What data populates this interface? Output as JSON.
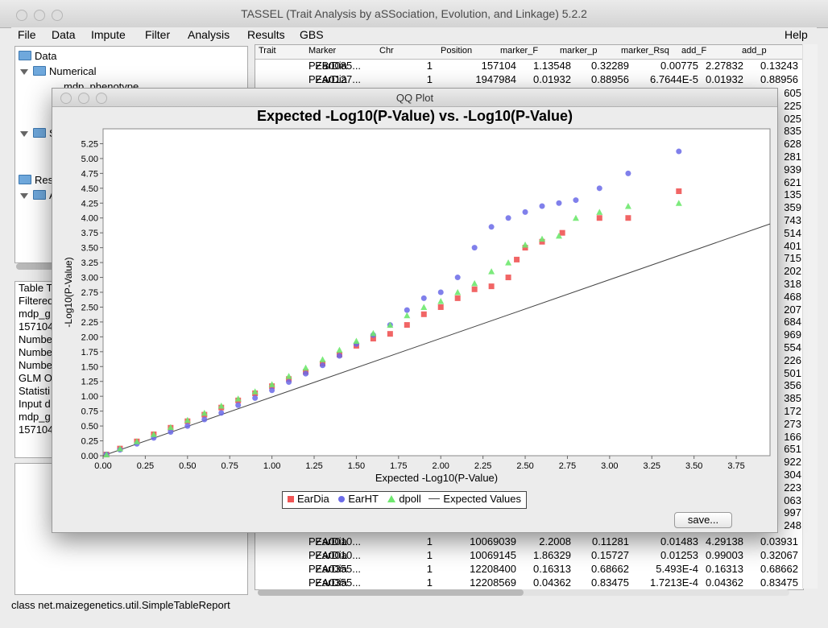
{
  "window": {
    "title": "TASSEL (Trait Analysis by aSSociation, Evolution, and Linkage) 5.2.2"
  },
  "menu": [
    "File",
    "Data",
    "Impute",
    "Filter",
    "Analysis",
    "Results",
    "GBS"
  ],
  "menu_help": "Help",
  "tree": {
    "data": "Data",
    "numerical": "Numerical",
    "phenotype": "mdp_phenotype",
    "s_node": "S",
    "results": "Resu",
    "a_node": "A"
  },
  "info": [
    "Table T",
    "Filtered",
    "mdp_g",
    "157104",
    "Numbe",
    "Numbe",
    "Numbe",
    "GLM O",
    "Statisti",
    "Input d",
    "mdp_g",
    "157104"
  ],
  "table": {
    "headers": [
      "Trait",
      "Marker",
      "Chr",
      "Position",
      "marker_F",
      "marker_p",
      "marker_Rsq",
      "add_F",
      "add_p"
    ],
    "top_rows": [
      [
        "EarDia",
        "PZB0085...",
        "1",
        "157104",
        "1.13548",
        "0.32289",
        "0.00775",
        "2.27832",
        "0.13243"
      ],
      [
        "EarDia",
        "PZA0127...",
        "1",
        "1947984",
        "0.01932",
        "0.88956",
        "6.7644E-5",
        "0.01932",
        "0.88956"
      ]
    ],
    "right_values": [
      "605",
      "225",
      "025",
      "835",
      "628",
      "281",
      "939",
      "621",
      "135",
      "359",
      "743",
      "514",
      "401",
      "715",
      "202",
      "318",
      "468",
      "207",
      "684",
      "969",
      "554",
      "226",
      "501",
      "356",
      "385",
      "172",
      "273",
      "166",
      "651",
      "922",
      "304",
      "223",
      "063",
      "997",
      "248"
    ],
    "bottom_rows": [
      [
        "EarDia",
        "PZA0010...",
        "1",
        "10069039",
        "2.2008",
        "0.11281",
        "0.01483",
        "4.29138",
        "0.03931"
      ],
      [
        "EarDia",
        "PZA0010...",
        "1",
        "10069145",
        "1.86329",
        "0.15727",
        "0.01253",
        "0.99003",
        "0.32067"
      ],
      [
        "EarDia",
        "PZA0355...",
        "1",
        "12208400",
        "0.16313",
        "0.68662",
        "5.493E-4",
        "0.16313",
        "0.68662"
      ],
      [
        "EarDia",
        "PZA0355...",
        "1",
        "12208569",
        "0.04362",
        "0.83475",
        "1.7213E-4",
        "0.04362",
        "0.83475"
      ]
    ]
  },
  "status": "class net.maizegenetics.util.SimpleTableReport",
  "qq": {
    "window_title": "QQ Plot",
    "save_label": "save..."
  },
  "colors": {
    "eardia": "#f05454",
    "earht": "#6a6ae8",
    "dpoll": "#6ee86e",
    "expected": "#444444"
  },
  "chart_data": {
    "type": "scatter",
    "title": "Expected -Log10(P-Value) vs. -Log10(P-Value)",
    "xlabel": "Expected -Log10(P-Value)",
    "ylabel": "-Log10(P-Value)",
    "xlim": [
      0,
      3.95
    ],
    "ylim": [
      0,
      5.5
    ],
    "xticks": [
      "0.00",
      "0.25",
      "0.50",
      "0.75",
      "1.00",
      "1.25",
      "1.50",
      "1.75",
      "2.00",
      "2.25",
      "2.50",
      "2.75",
      "3.00",
      "3.25",
      "3.50",
      "3.75"
    ],
    "yticks": [
      "0.00",
      "0.25",
      "0.50",
      "0.75",
      "1.00",
      "1.25",
      "1.50",
      "1.75",
      "2.00",
      "2.25",
      "2.50",
      "2.75",
      "3.00",
      "3.25",
      "3.50",
      "3.75",
      "4.00",
      "4.25",
      "4.50",
      "4.75",
      "5.00",
      "5.25"
    ],
    "legend": "bottom",
    "series": [
      {
        "name": "EarDia",
        "marker": "square",
        "points": [
          [
            0.02,
            0.02
          ],
          [
            0.1,
            0.12
          ],
          [
            0.2,
            0.24
          ],
          [
            0.3,
            0.36
          ],
          [
            0.4,
            0.47
          ],
          [
            0.5,
            0.58
          ],
          [
            0.6,
            0.69
          ],
          [
            0.7,
            0.81
          ],
          [
            0.8,
            0.93
          ],
          [
            0.9,
            1.05
          ],
          [
            1.0,
            1.17
          ],
          [
            1.1,
            1.29
          ],
          [
            1.2,
            1.41
          ],
          [
            1.3,
            1.55
          ],
          [
            1.4,
            1.7
          ],
          [
            1.5,
            1.85
          ],
          [
            1.6,
            1.97
          ],
          [
            1.7,
            2.05
          ],
          [
            1.8,
            2.2
          ],
          [
            1.9,
            2.38
          ],
          [
            2.0,
            2.5
          ],
          [
            2.1,
            2.65
          ],
          [
            2.2,
            2.8
          ],
          [
            2.3,
            2.85
          ],
          [
            2.4,
            3.0
          ],
          [
            2.45,
            3.3
          ],
          [
            2.5,
            3.5
          ],
          [
            2.6,
            3.6
          ],
          [
            2.72,
            3.75
          ],
          [
            2.94,
            4.0
          ],
          [
            3.11,
            4.0
          ],
          [
            3.41,
            4.45
          ]
        ]
      },
      {
        "name": "EarHT",
        "marker": "circle",
        "points": [
          [
            0.02,
            0.02
          ],
          [
            0.1,
            0.1
          ],
          [
            0.2,
            0.2
          ],
          [
            0.3,
            0.3
          ],
          [
            0.4,
            0.4
          ],
          [
            0.5,
            0.5
          ],
          [
            0.6,
            0.61
          ],
          [
            0.7,
            0.72
          ],
          [
            0.8,
            0.85
          ],
          [
            0.9,
            0.97
          ],
          [
            1.0,
            1.1
          ],
          [
            1.1,
            1.24
          ],
          [
            1.2,
            1.38
          ],
          [
            1.3,
            1.52
          ],
          [
            1.4,
            1.68
          ],
          [
            1.5,
            1.88
          ],
          [
            1.6,
            2.03
          ],
          [
            1.7,
            2.2
          ],
          [
            1.8,
            2.45
          ],
          [
            1.9,
            2.65
          ],
          [
            2.0,
            2.75
          ],
          [
            2.1,
            3.0
          ],
          [
            2.2,
            3.5
          ],
          [
            2.3,
            3.85
          ],
          [
            2.4,
            4.0
          ],
          [
            2.5,
            4.1
          ],
          [
            2.6,
            4.2
          ],
          [
            2.7,
            4.25
          ],
          [
            2.8,
            4.3
          ],
          [
            2.94,
            4.5
          ],
          [
            3.11,
            4.75
          ],
          [
            3.41,
            5.12
          ]
        ]
      },
      {
        "name": "dpoll",
        "marker": "triangle",
        "points": [
          [
            0.02,
            0.02
          ],
          [
            0.1,
            0.12
          ],
          [
            0.2,
            0.24
          ],
          [
            0.3,
            0.36
          ],
          [
            0.4,
            0.48
          ],
          [
            0.5,
            0.6
          ],
          [
            0.6,
            0.72
          ],
          [
            0.7,
            0.84
          ],
          [
            0.8,
            0.96
          ],
          [
            0.9,
            1.08
          ],
          [
            1.0,
            1.2
          ],
          [
            1.1,
            1.34
          ],
          [
            1.2,
            1.48
          ],
          [
            1.3,
            1.62
          ],
          [
            1.4,
            1.78
          ],
          [
            1.5,
            1.93
          ],
          [
            1.6,
            2.06
          ],
          [
            1.7,
            2.2
          ],
          [
            1.8,
            2.36
          ],
          [
            1.9,
            2.5
          ],
          [
            2.0,
            2.6
          ],
          [
            2.1,
            2.75
          ],
          [
            2.2,
            2.9
          ],
          [
            2.3,
            3.1
          ],
          [
            2.4,
            3.25
          ],
          [
            2.5,
            3.55
          ],
          [
            2.6,
            3.65
          ],
          [
            2.7,
            3.7
          ],
          [
            2.8,
            4.0
          ],
          [
            2.94,
            4.1
          ],
          [
            3.11,
            4.2
          ],
          [
            3.41,
            4.25
          ]
        ]
      }
    ],
    "reference": {
      "name": "Expected Values",
      "points": [
        [
          0,
          0
        ],
        [
          3.95,
          3.9
        ]
      ]
    }
  }
}
